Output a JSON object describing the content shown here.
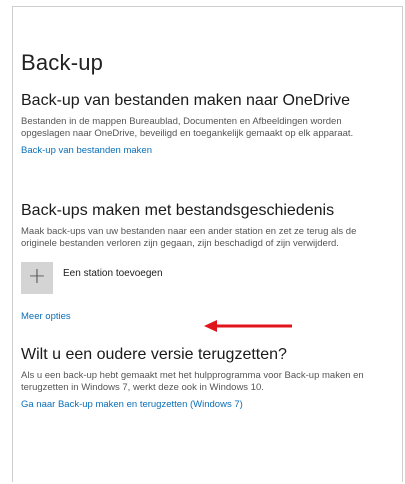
{
  "page_title": "Back-up",
  "onedrive": {
    "title": "Back-up van bestanden maken naar OneDrive",
    "description": "Bestanden in de mappen Bureaublad, Documenten en Afbeeldingen worden opgeslagen naar OneDrive, beveiligd en toegankelijk gemaakt op elk apparaat.",
    "link": "Back-up van bestanden maken"
  },
  "file_history": {
    "title": "Back-ups maken met bestandsgeschiedenis",
    "description": "Maak back-ups van uw bestanden naar een ander station en zet ze terug als de originele bestanden verloren zijn gegaan, zijn beschadigd of zijn verwijderd.",
    "add_drive_label": "Een station toevoegen",
    "add_icon": "plus-icon",
    "more_options_link": "Meer opties"
  },
  "older": {
    "title": "Wilt u een oudere versie terugzetten?",
    "description": "Als u een back-up hebt gemaakt met het hulpprogramma voor Back-up maken en terugzetten in Windows 7, werkt deze ook in Windows 10.",
    "link": "Ga naar Back-up maken en terugzetten (Windows 7)"
  },
  "colors": {
    "link": "#0a6fb8",
    "annotation_arrow": "#e0151b",
    "add_button_bg": "#d4d4d4"
  }
}
